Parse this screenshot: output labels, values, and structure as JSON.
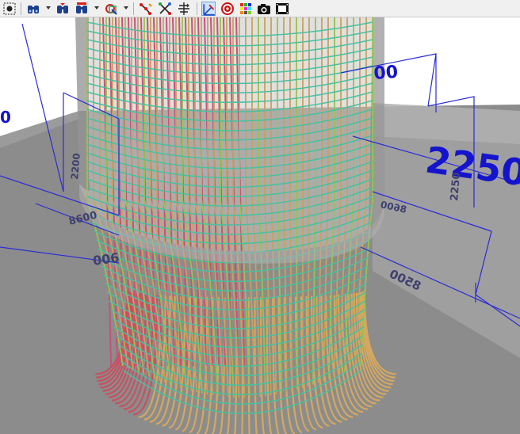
{
  "toolbar": {
    "buttons": [
      {
        "name": "select-all-icon"
      },
      {
        "name": "find-icon"
      },
      {
        "name": "find-next-icon"
      },
      {
        "name": "find-filter-icon"
      },
      {
        "name": "layer-filter-icon"
      },
      {
        "name": "pick-node-icon"
      },
      {
        "name": "pick-element-icon"
      },
      {
        "name": "align-icon"
      },
      {
        "name": "axes-icon"
      },
      {
        "name": "target-icon"
      },
      {
        "name": "color-palette-icon"
      },
      {
        "name": "camera-icon"
      },
      {
        "name": "record-video-icon"
      }
    ]
  },
  "viewport": {
    "dimensions": {
      "big": "2250",
      "top_right": "00",
      "left_edge": "0",
      "left_vertical": "2200",
      "left_diag": "8600",
      "left_front": "006",
      "right_vertical": "2250",
      "right_diag_upper": "8600",
      "right_diag_lower": "8500"
    },
    "colors": {
      "background": "#ffffff",
      "ground": "#8c8c8c",
      "dim_line": "#2b2bd6",
      "dim_text_big": "#1414cc",
      "dim_text_small": "#40406e",
      "rebar_vertical": "#c9a25a",
      "rebar_hoop": "#49c0a0",
      "rebar_inner": "#c8507a",
      "starter_bar": "#d4a860"
    }
  }
}
